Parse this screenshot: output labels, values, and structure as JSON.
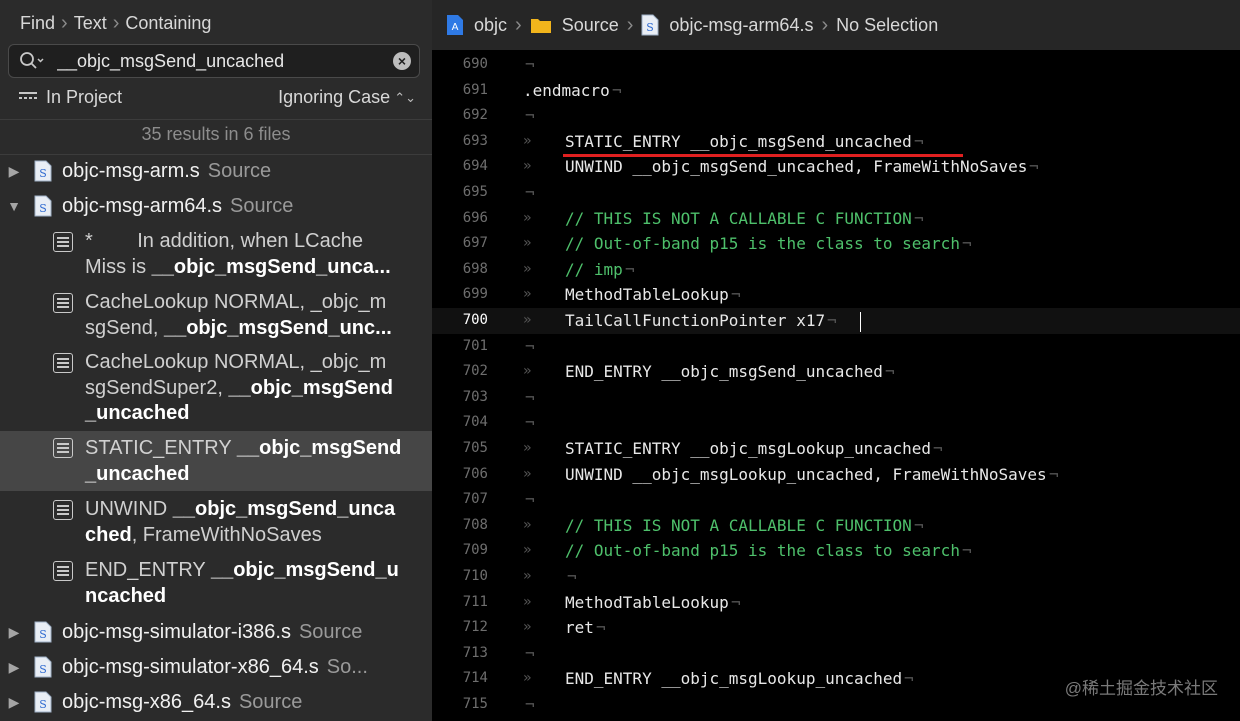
{
  "find_bar": {
    "crumbs": [
      "Find",
      "Text",
      "Containing"
    ]
  },
  "search": {
    "value": "__objc_msgSend_uncached",
    "placeholder": ""
  },
  "scope": {
    "label": "In Project",
    "case": "Ignoring Case"
  },
  "summary": "35 results in 6 files",
  "files": [
    {
      "name": "objc-msg-arm.s",
      "source": "Source",
      "expanded": false
    },
    {
      "name": "objc-msg-arm64.s",
      "source": "Source",
      "expanded": true
    },
    {
      "name": "objc-msg-simulator-i386.s",
      "source": "Source",
      "expanded": false
    },
    {
      "name": "objc-msg-simulator-x86_64.s",
      "source": "So...",
      "expanded": false
    },
    {
      "name": "objc-msg-x86_64.s",
      "source": "Source",
      "expanded": false
    }
  ],
  "results": [
    {
      "line1_pre": "*        In addition, when LCache",
      "line2_pre": "Miss is ",
      "line2_match": "__objc_msgSend_unca...",
      "line3_match": "",
      "line3_post": ""
    },
    {
      "line1_pre": "CacheLookup NORMAL, _objc_m",
      "line2_pre": "sgSend, ",
      "line2_match": "__objc_msgSend_unc...",
      "line3_match": "",
      "line3_post": ""
    },
    {
      "line1_pre": "CacheLookup NORMAL, _objc_m",
      "line2_pre": "sgSendSuper2, ",
      "line2_match": "__objc_msgSend",
      "line3_match": "_uncached",
      "line3_post": ""
    },
    {
      "line1_pre": "STATIC_ENTRY ",
      "line1_match": "__objc_msgSend",
      "line2_match": "_uncached"
    },
    {
      "line1_pre": "UNWIND ",
      "line1_match": "__objc_msgSend_unca",
      "line2_match": "ched",
      "line2_post": ", FrameWithNoSaves"
    },
    {
      "line1_pre": "END_ENTRY ",
      "line1_match": "__objc_msgSend_u",
      "line2_match": "ncached"
    }
  ],
  "jumpbar": {
    "project": "objc",
    "folder": "Source",
    "file": "objc-msg-arm64.s",
    "selection": "No Selection"
  },
  "code": {
    "lines": [
      {
        "n": "690",
        "text": "",
        "indent": false,
        "comment": false
      },
      {
        "n": "691",
        "text": ".endmacro",
        "indent": false,
        "comment": false
      },
      {
        "n": "692",
        "text": "",
        "indent": false,
        "comment": false
      },
      {
        "n": "693",
        "text": "STATIC_ENTRY __objc_msgSend_uncached",
        "indent": true,
        "comment": false
      },
      {
        "n": "694",
        "text": "UNWIND __objc_msgSend_uncached, FrameWithNoSaves",
        "indent": true,
        "comment": false
      },
      {
        "n": "695",
        "text": "",
        "indent": false,
        "comment": false
      },
      {
        "n": "696",
        "text": "// THIS IS NOT A CALLABLE C FUNCTION",
        "indent": true,
        "comment": true
      },
      {
        "n": "697",
        "text": "// Out-of-band p15 is the class to search",
        "indent": true,
        "comment": true
      },
      {
        "n": "698",
        "text": "// imp",
        "indent": true,
        "comment": true
      },
      {
        "n": "699",
        "text": "MethodTableLookup",
        "indent": true,
        "comment": false
      },
      {
        "n": "700",
        "text": "TailCallFunctionPointer x17",
        "indent": true,
        "comment": false
      },
      {
        "n": "701",
        "text": "",
        "indent": false,
        "comment": false
      },
      {
        "n": "702",
        "text": "END_ENTRY __objc_msgSend_uncached",
        "indent": true,
        "comment": false
      },
      {
        "n": "703",
        "text": "",
        "indent": false,
        "comment": false
      },
      {
        "n": "704",
        "text": "",
        "indent": false,
        "comment": false
      },
      {
        "n": "705",
        "text": "STATIC_ENTRY __objc_msgLookup_uncached",
        "indent": true,
        "comment": false
      },
      {
        "n": "706",
        "text": "UNWIND __objc_msgLookup_uncached, FrameWithNoSaves",
        "indent": true,
        "comment": false
      },
      {
        "n": "707",
        "text": "",
        "indent": false,
        "comment": false
      },
      {
        "n": "708",
        "text": "// THIS IS NOT A CALLABLE C FUNCTION",
        "indent": true,
        "comment": true
      },
      {
        "n": "709",
        "text": "// Out-of-band p15 is the class to search",
        "indent": true,
        "comment": true
      },
      {
        "n": "710",
        "text": "",
        "indent": true,
        "comment": false
      },
      {
        "n": "711",
        "text": "MethodTableLookup",
        "indent": true,
        "comment": false
      },
      {
        "n": "712",
        "text": "ret",
        "indent": true,
        "comment": false
      },
      {
        "n": "713",
        "text": "",
        "indent": false,
        "comment": false
      },
      {
        "n": "714",
        "text": "END_ENTRY __objc_msgLookup_uncached",
        "indent": true,
        "comment": false
      },
      {
        "n": "715",
        "text": "",
        "indent": false,
        "comment": false
      }
    ],
    "active_line": "700"
  },
  "watermark": "@稀土掘金技术社区",
  "colors": {
    "comment": "#4ec06b",
    "highlight_underline": "#e02020",
    "folder": "#f2b51c"
  }
}
